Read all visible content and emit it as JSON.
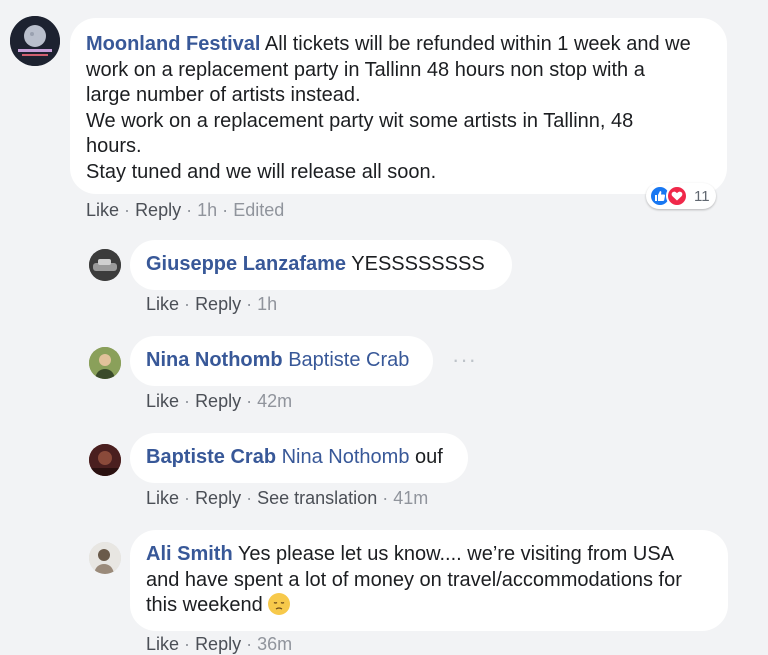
{
  "comments": [
    {
      "author": "Moonland Festival",
      "text_lines": [
        "All tickets will be refunded within 1 week and we",
        "work on a replacement party in Tallinn 48 hours non stop with a",
        "large number of artists instead.",
        "We work on a replacement party wit some artists in Tallinn, 48",
        "hours.",
        "Stay tuned and we will release all soon."
      ],
      "like": "Like",
      "reply": "Reply",
      "time": "1h",
      "edited": "Edited",
      "reaction_count": "11",
      "reaction_icons": [
        "like-icon",
        "love-icon"
      ]
    },
    {
      "author": "Giuseppe Lanzafame",
      "text": "YESSSSSSSS",
      "like": "Like",
      "reply": "Reply",
      "time": "1h"
    },
    {
      "author": "Nina Nothomb",
      "mention": "Baptiste Crab",
      "like": "Like",
      "reply": "Reply",
      "time": "42m"
    },
    {
      "author": "Baptiste Crab",
      "mention": "Nina Nothomb",
      "text": "ouf",
      "like": "Like",
      "reply": "Reply",
      "see_translation": "See translation",
      "time": "41m"
    },
    {
      "author": "Ali Smith",
      "text_lines": [
        "Yes please let us know.... we’re visiting from USA",
        "and have spent a lot of money on travel/accommodations for",
        "this weekend"
      ],
      "emoji": "disappointed-face-emoji",
      "like": "Like",
      "reply": "Reply",
      "time": "36m"
    }
  ],
  "separator": "·",
  "more_options": "···",
  "colors": {
    "background": "#f2f3f5",
    "bubble": "#ffffff",
    "name": "#385898",
    "like_blue": "#1877f2",
    "love_red": "#f0284a"
  }
}
